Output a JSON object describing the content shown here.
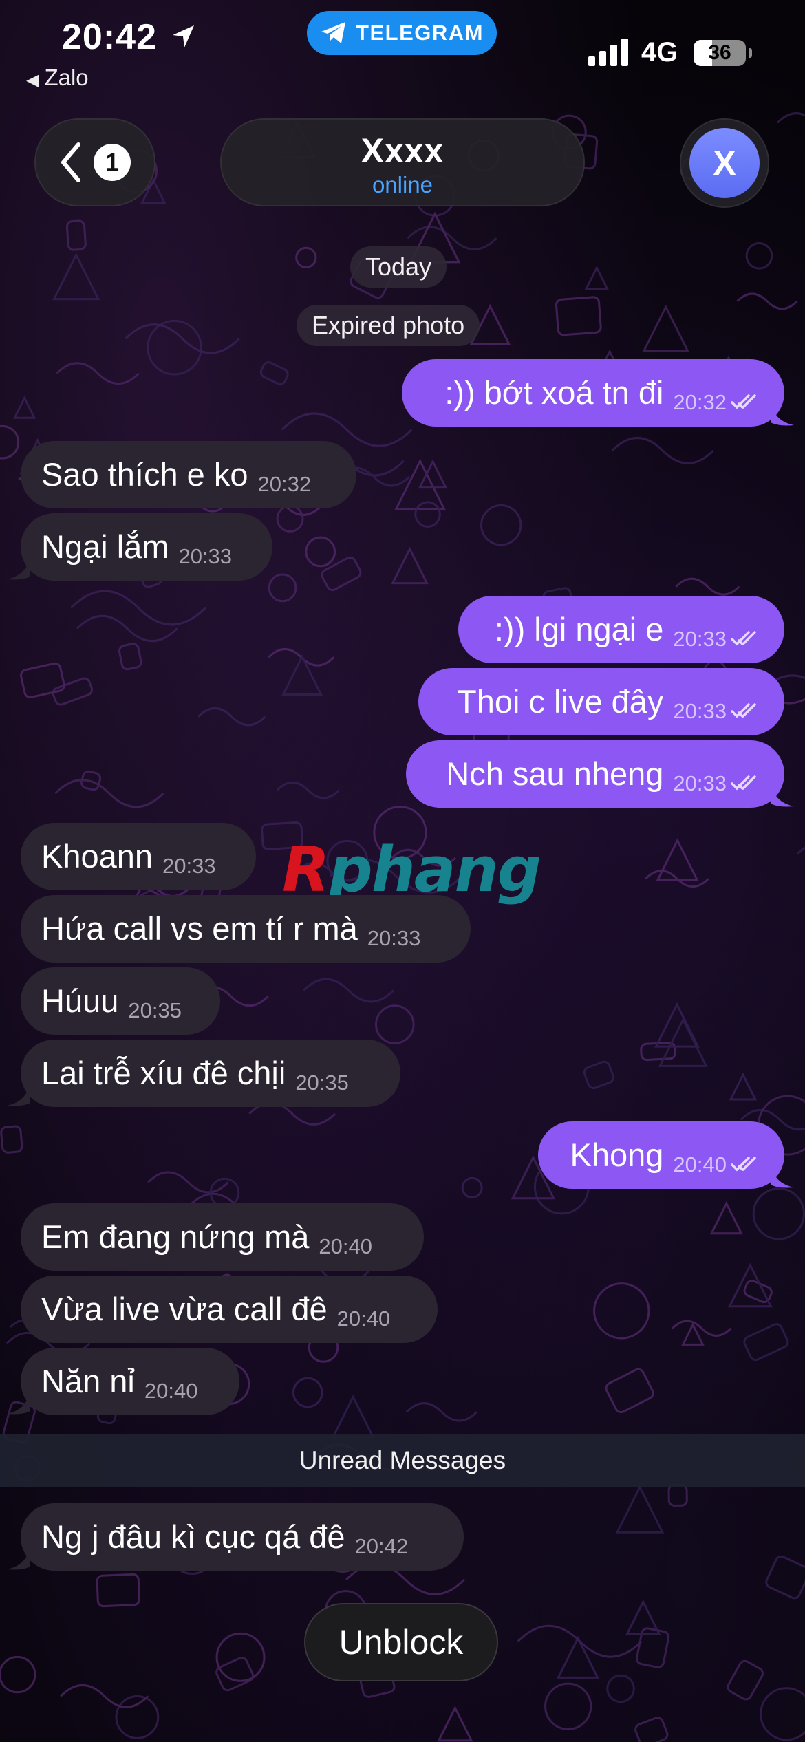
{
  "status_bar": {
    "time": "20:42",
    "back_app": "Zalo",
    "pill_label": "TELEGRAM",
    "network": "4G",
    "battery_percent": 36,
    "battery_label": "36"
  },
  "header": {
    "back_badge": "1",
    "chat_name": "Xxxx",
    "chat_status": "online",
    "avatar_letter": "X"
  },
  "service": {
    "date": "Today",
    "expired": "Expired photo"
  },
  "messages": [
    {
      "dir": "out",
      "text": ":)) bớt xoá tn đi",
      "time": "20:32"
    },
    {
      "dir": "in",
      "text": "Sao thích e ko",
      "time": "20:32"
    },
    {
      "dir": "in",
      "text": "Ngại lắm",
      "time": "20:33"
    },
    {
      "dir": "out",
      "text": ":)) lgi ngại e",
      "time": "20:33"
    },
    {
      "dir": "out",
      "text": "Thoi c live đây",
      "time": "20:33"
    },
    {
      "dir": "out",
      "text": "Nch sau nheng",
      "time": "20:33"
    },
    {
      "dir": "in",
      "text": "Khoann",
      "time": "20:33"
    },
    {
      "dir": "in",
      "text": "Hứa call vs em tí r mà",
      "time": "20:33"
    },
    {
      "dir": "in",
      "text": "Húuu",
      "time": "20:35"
    },
    {
      "dir": "in",
      "text": "Lai trễ xíu đê chịi",
      "time": "20:35"
    },
    {
      "dir": "out",
      "text": "Khong",
      "time": "20:40"
    },
    {
      "dir": "in",
      "text": "Em đang nứng mà",
      "time": "20:40"
    },
    {
      "dir": "in",
      "text": "Vừa live vừa call đê",
      "time": "20:40"
    },
    {
      "dir": "in",
      "text": "Năn nỉ",
      "time": "20:40"
    },
    {
      "dir": "in",
      "text": "Ng j đâu kì cục qá đê",
      "time": "20:42"
    }
  ],
  "unread_label": "Unread Messages",
  "watermark": {
    "first": "R",
    "rest": "phang"
  },
  "unblock_label": "Unblock",
  "colors": {
    "outgoing_bubble": "#8c57f2",
    "incoming_bubble": "#2b2531",
    "accent_blue": "#4aa3ff",
    "telegram_pill": "#1a8ef0",
    "avatar": "#6c7bf8"
  }
}
